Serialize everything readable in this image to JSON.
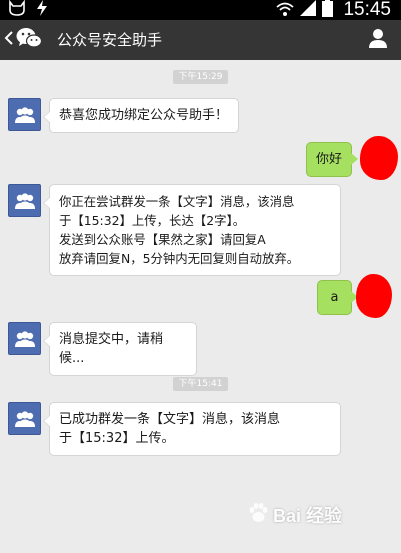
{
  "status_bar": {
    "time": "15:45",
    "icons": [
      "cat-notification-icon",
      "lightning-notification-icon",
      "wifi-icon",
      "signal-icon",
      "battery-icon"
    ]
  },
  "header": {
    "back_icon": "chevron-left-icon",
    "app_icon": "wechat-icon",
    "title": "公众号安全助手",
    "profile_icon": "person-icon"
  },
  "colors": {
    "status_bar": "#000000",
    "title_bar": "#353535",
    "chat_background": "#ebebeb",
    "incoming_bubble": "#ffffff",
    "outgoing_bubble": "#a6e060",
    "avatar": "#4e6cb0",
    "timestamp_pill": "#d2d2d2",
    "redaction": "#ff0000"
  },
  "messages": [
    {
      "kind": "timestamp",
      "text": "下午15:29"
    },
    {
      "kind": "incoming",
      "avatar_icon": "official-account-avatar-icon",
      "text": "恭喜您成功绑定公众号助手！"
    },
    {
      "kind": "outgoing",
      "text": "你好"
    },
    {
      "kind": "incoming",
      "avatar_icon": "official-account-avatar-icon",
      "text": "你正在尝试群发一条【文字】消息，该消息\n于【15:32】上传，长达【2字】。\n发送到公众账号【果然之家】请回复A\n放弃请回复N，5分钟内无回复则自动放弃。"
    },
    {
      "kind": "outgoing",
      "text": "a"
    },
    {
      "kind": "incoming",
      "avatar_icon": "official-account-avatar-icon",
      "text": "消息提交中，请稍候..."
    },
    {
      "kind": "timestamp",
      "text": "下午15:41"
    },
    {
      "kind": "incoming",
      "avatar_icon": "official-account-avatar-icon",
      "text": "已成功群发一条【文字】消息，该消息\n于【15:32】上传。"
    }
  ],
  "watermark": {
    "text": "Bai 经验",
    "icon": "baidu-paw-icon"
  }
}
